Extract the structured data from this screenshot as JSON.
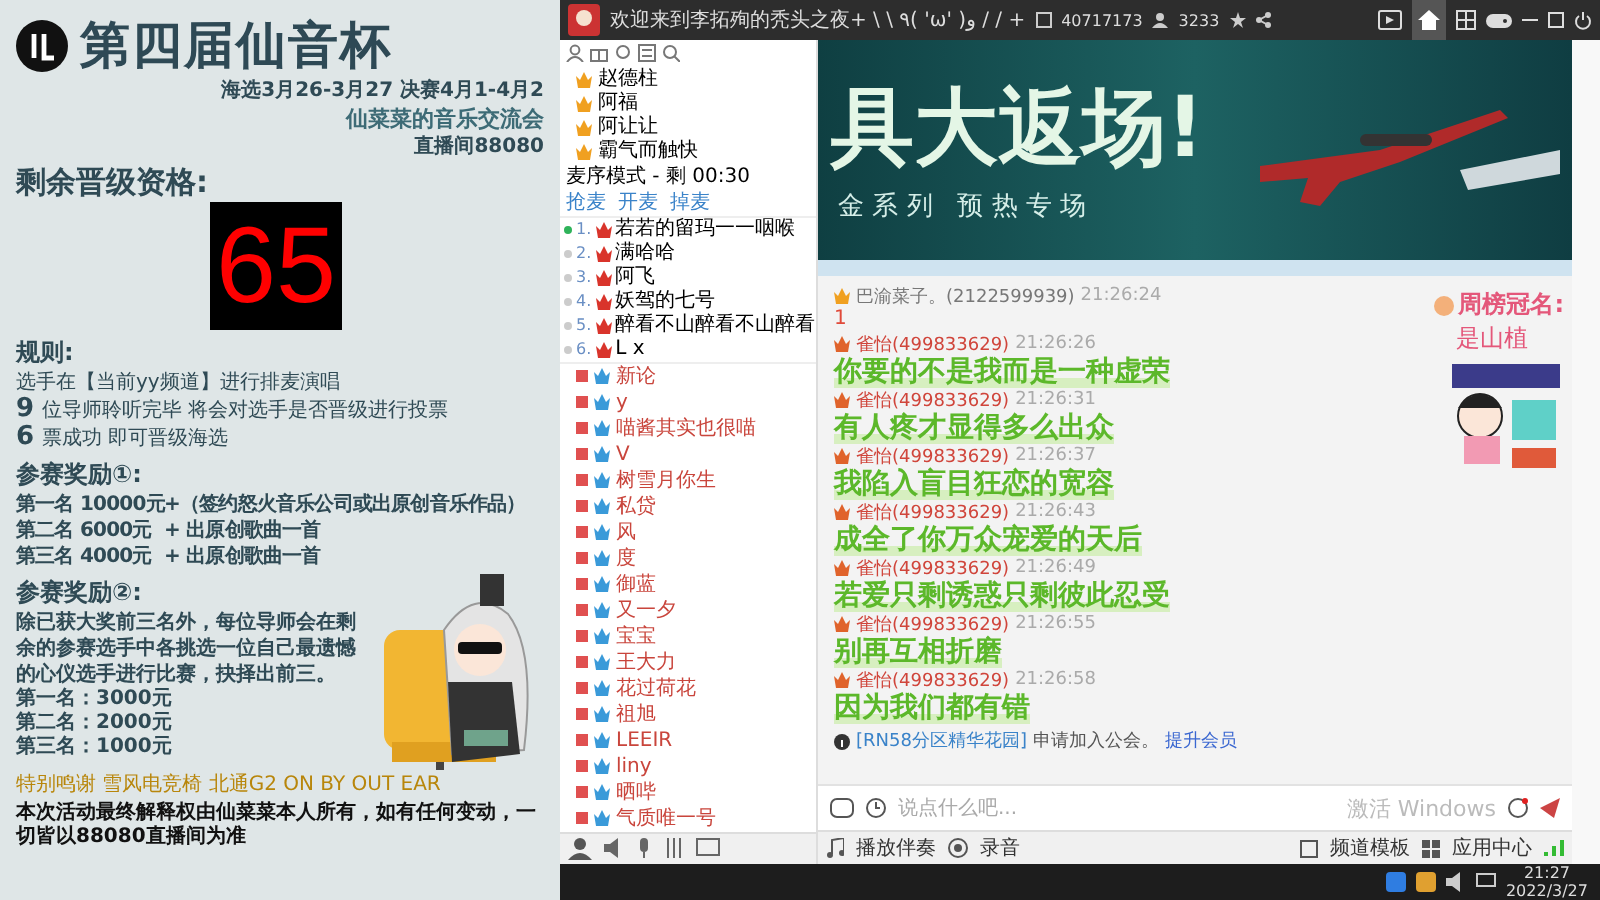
{
  "poster": {
    "title": "第四届仙音杯",
    "schedule": "海选3月26-3月27  决赛4月1-4月2",
    "subtitle": "仙菜菜的音乐交流会",
    "room": "直播间88080",
    "remaining_label": "剩余晋级资格:",
    "remaining_count": "65",
    "rules_title": "规则:",
    "rules": [
      {
        "text": "选手在【当前yy频道】进行排麦演唱"
      },
      {
        "num": "9",
        "text": "位导师聆听完毕  将会对选手是否晋级进行投票"
      },
      {
        "num": "6",
        "text": "票成功  即可晋级海选"
      }
    ],
    "reward1": {
      "title": "参赛奖励①:",
      "rows": [
        {
          "rank": "第一名",
          "amount": "10000元",
          "extra": "+（签约怒火音乐公司或出原创音乐作品）"
        },
        {
          "rank": "第二名",
          "amount": "6000元",
          "extra": "+ 出原创歌曲一首"
        },
        {
          "rank": "第三名",
          "amount": "4000元",
          "extra": "+ 出原创歌曲一首"
        }
      ]
    },
    "reward2": {
      "title": "参赛奖励②:",
      "text": "除已获大奖前三名外，每位导师会在剩余的参赛选手中各挑选一位自己最遗憾的心仪选手进行比赛，抉择出前三。",
      "prizes": [
        "第一名：3000元",
        "第二名：2000元",
        "第三名：1000元"
      ]
    },
    "sponsor": "特别鸣谢 雪风电竞椅  北通G2  ON BY OUT EAR",
    "footer": "本次活动最终解释权由仙菜菜本人所有，如有任何变动，一切皆以88080直播间为准"
  },
  "client": {
    "title": "欢迎来到李拓殉的秃头之夜+ \\ \\ ٩( 'ω' )و / / +",
    "room_id": "40717173",
    "online_count": "3233",
    "tree": [
      "赵德柱",
      "阿福",
      "阿让让",
      "霸气而触快"
    ],
    "queue": {
      "mode": "麦序模式 - 剩 00:30",
      "actions": [
        "抢麦",
        "开麦",
        "掉麦"
      ],
      "list": [
        {
          "rank": "1.",
          "name": "若若的留玛一一咽喉",
          "selected": true
        },
        {
          "rank": "2.",
          "name": "满哈哈",
          "selected": false
        },
        {
          "rank": "3.",
          "name": "阿飞",
          "selected": false
        },
        {
          "rank": "4.",
          "name": "妖驾的七号",
          "selected": false
        },
        {
          "rank": "5.",
          "name": "醉看不山醉看不山醉看",
          "selected": false
        },
        {
          "rank": "6.",
          "name": "L x",
          "selected": false
        }
      ]
    },
    "users": [
      "新论",
      "y",
      "喵酱其实也很喵",
      "V",
      "树雪月你生",
      "私贷",
      "风",
      "度",
      "御蓝",
      "又一夕",
      "宝宝",
      "王大力",
      "花过荷花",
      "祖旭",
      "LEEIR",
      "liny",
      "晒哔",
      "气质唯一号"
    ],
    "banner": {
      "headline": "具大返场!",
      "tagline": "金 系 列   预 热 专 场"
    },
    "messages": [
      {
        "kind": "plain",
        "sender": "巴渝菜子。(2122599939)",
        "time": "21:26:24",
        "text": "1"
      },
      {
        "kind": "lyric",
        "sender": "雀怡(499833629)",
        "time": "21:26:26",
        "text": "你要的不是我而是一种虚荣"
      },
      {
        "kind": "lyric",
        "sender": "雀怡(499833629)",
        "time": "21:26:31",
        "text": "有人疼才显得多么出众"
      },
      {
        "kind": "lyric",
        "sender": "雀怡(499833629)",
        "time": "21:26:37",
        "text": "我陷入盲目狂恋的宽容"
      },
      {
        "kind": "lyric",
        "sender": "雀怡(499833629)",
        "time": "21:26:43",
        "text": "成全了你万众宠爱的天后"
      },
      {
        "kind": "lyric",
        "sender": "雀怡(499833629)",
        "time": "21:26:49",
        "text": "若爱只剩诱惑只剩彼此忍受"
      },
      {
        "kind": "lyric",
        "sender": "雀怡(499833629)",
        "time": "21:26:55",
        "text": "别再互相折磨"
      },
      {
        "kind": "lyric",
        "sender": "雀怡(499833629)",
        "time": "21:26:58",
        "text": "因为我们都有错"
      }
    ],
    "notice": {
      "tag": "[RN58分区精华花园]",
      "text": "申请加入公会。",
      "link": "提升会员"
    },
    "top_rank": {
      "label": "周榜冠名:",
      "name": "是山植"
    },
    "input_placeholder": "说点什么吧...",
    "watermark": "激活 Windows",
    "toolbar": [
      "播放伴奏",
      "录音"
    ],
    "toolbar_right": [
      "频道模板",
      "应用中心"
    ],
    "taskbar": {
      "time": "21:27",
      "date": "2022/3/27"
    }
  }
}
